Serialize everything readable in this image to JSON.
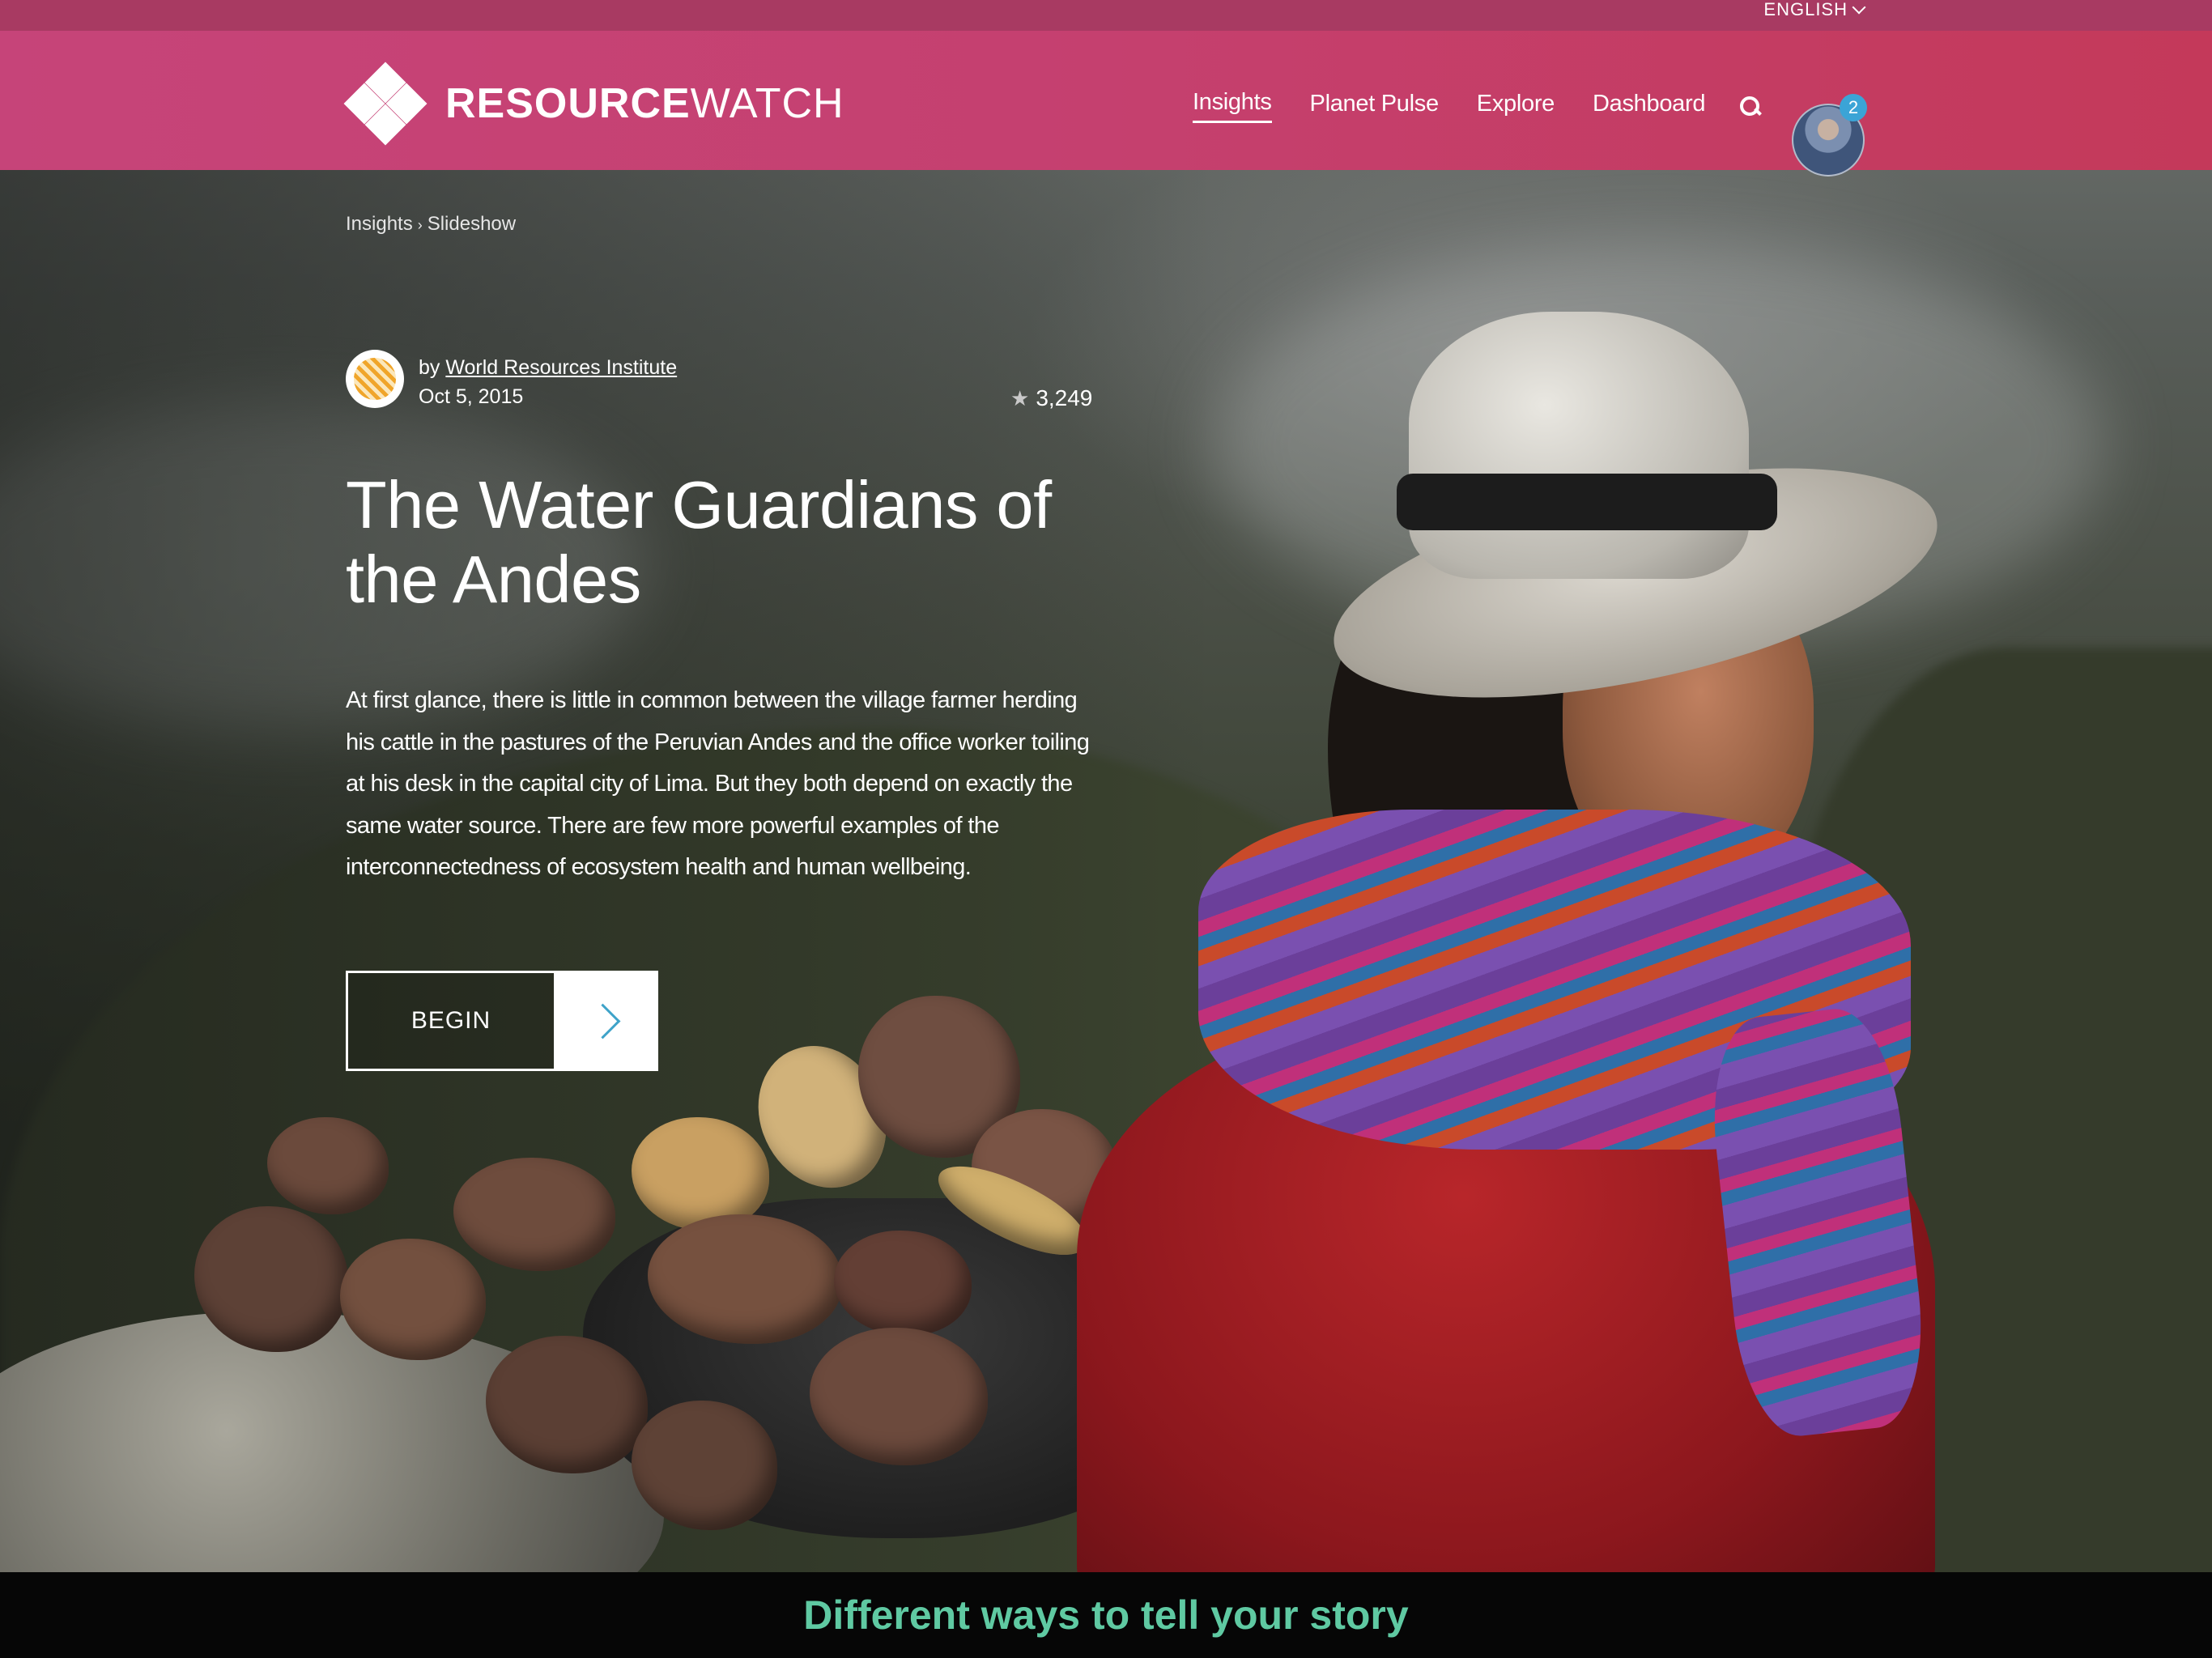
{
  "language": {
    "selected": "ENGLISH"
  },
  "brand": {
    "name_bold": "RESOURCE",
    "name_light": "WATCH"
  },
  "nav": {
    "items": [
      {
        "label": "Insights",
        "active": true
      },
      {
        "label": "Planet Pulse"
      },
      {
        "label": "Explore"
      },
      {
        "label": "Dashboard"
      }
    ],
    "search_icon": "search-icon",
    "notifications_count": "2"
  },
  "breadcrumb": {
    "root": "Insights",
    "separator": "›",
    "current": "Slideshow"
  },
  "story": {
    "author_prefix": "by",
    "author": "World Resources Institute",
    "date": "Oct 5, 2015",
    "views": "3,249",
    "title": "The Water Guardians of the Andes",
    "description": "At first glance, there is little in common between the village farmer herding his cattle in the pastures of the Peruvian Andes and the office worker toiling at his desk in the capital city of Lima. But they both depend on exactly the same water source. There are few more powerful examples of the interconnectedness of ecosystem health and human wellbeing.",
    "cta_label": "BEGIN"
  },
  "caption": "Different ways to tell your story",
  "colors": {
    "navbar": "#c64479",
    "accent": "#3fa3c9",
    "caption_text": "#5fc9a2",
    "badge": "#3ba4d6"
  }
}
